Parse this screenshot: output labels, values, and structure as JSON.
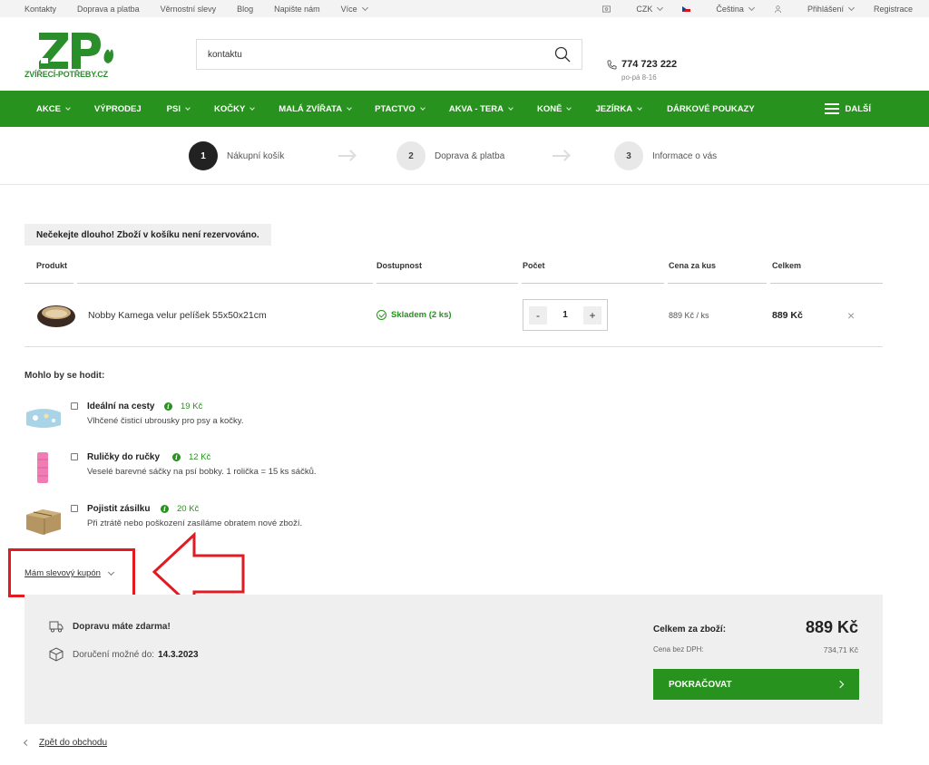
{
  "topbar": {
    "links": [
      "Kontakty",
      "Doprava a platba",
      "Věrnostní slevy",
      "Blog",
      "Napište nám"
    ],
    "more": "Více",
    "currency": "CZK",
    "language": "Čeština",
    "login": "Přihlášení",
    "register": "Registrace"
  },
  "header": {
    "logo_text": "ZVÍŘECÍ-POTŘEBY.CZ",
    "search_value": "kontaktu",
    "phone": "774 723 222",
    "hours": "po-pá 8-16"
  },
  "nav": {
    "items": [
      "AKCE",
      "VÝPRODEJ",
      "PSI",
      "KOČKY",
      "MALÁ ZVÍŘATA",
      "PTACTVO",
      "AKVA - TERA",
      "KONĚ",
      "JEZÍRKA",
      "DÁRKOVÉ POUKAZY"
    ],
    "more": "DALŠÍ"
  },
  "steps": [
    {
      "num": "1",
      "label": "Nákupní košík"
    },
    {
      "num": "2",
      "label": "Doprava & platba"
    },
    {
      "num": "3",
      "label": "Informace o vás"
    }
  ],
  "notice": "Nečekejte dlouho! Zboží v košíku není rezervováno.",
  "table": {
    "headers": [
      "Produkt",
      "Dostupnost",
      "Počet",
      "Cena za kus",
      "Celkem"
    ],
    "row": {
      "name": "Nobby Kamega velur pelíšek 55x50x21cm",
      "stock": "Skladem (2 ks)",
      "qty": "1",
      "minus": "-",
      "plus": "+",
      "unit_price": "889 Kč / ks",
      "total": "889 Kč",
      "remove": "×"
    }
  },
  "suggestions": {
    "title": "Mohlo by se hodit:",
    "items": [
      {
        "name": "Ideální na cesty",
        "price": "19 Kč",
        "desc": "Vlhčené čisticí ubrousky pro psy a kočky."
      },
      {
        "name": "Ruličky do ručky",
        "price": "12 Kč",
        "desc": "Veselé barevné sáčky na psí bobky. 1 rolička = 15 ks sáčků."
      },
      {
        "name": "Pojistit zásilku",
        "price": "20 Kč",
        "desc": "Při ztrátě nebo poškození zasíláme obratem nové zboží."
      }
    ]
  },
  "coupon": "Mám slevový kupón",
  "summary": {
    "shipping": "Dopravu máte zdarma!",
    "delivery_label": "Doručení možné do:",
    "delivery_date": "14.3.2023",
    "total_label": "Celkem za zboží:",
    "total_value": "889 Kč",
    "vat_label": "Cena bez DPH:",
    "vat_value": "734,71 Kč",
    "continue": "POKRAČOVAT"
  },
  "back": "Zpět do obchodu",
  "colors": {
    "brand_green": "#27921d",
    "annotation_red": "#e21b23"
  }
}
